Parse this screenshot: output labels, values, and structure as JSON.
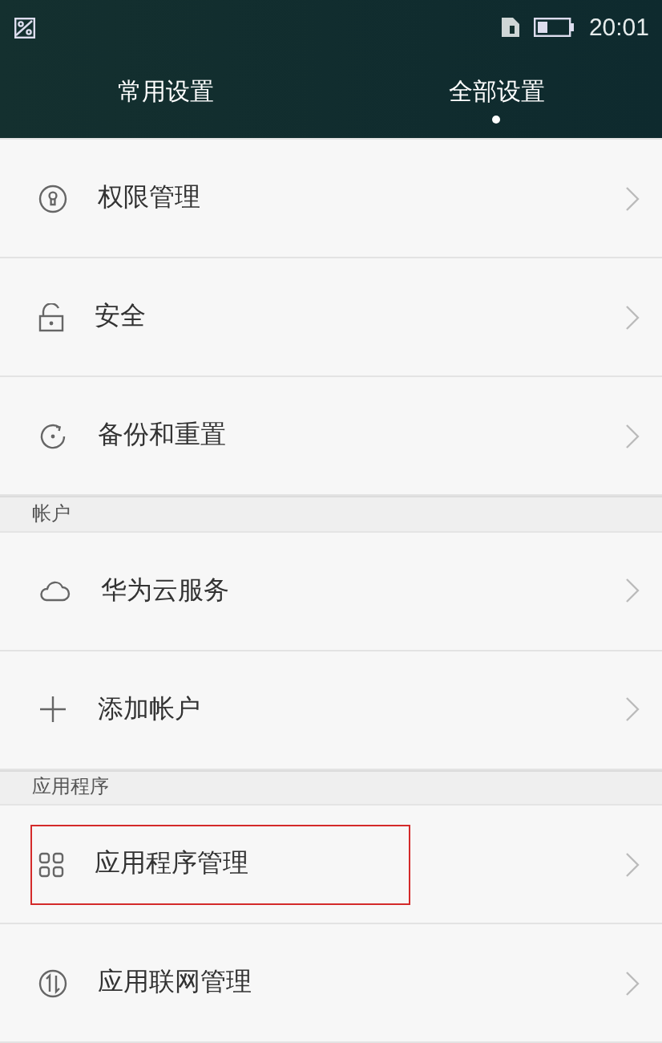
{
  "status_bar": {
    "time": "20:01"
  },
  "tabs": [
    {
      "label": "常用设置",
      "selected": false
    },
    {
      "label": "全部设置",
      "selected": true
    }
  ],
  "sections": [
    {
      "items": [
        {
          "kind": "permission",
          "label": "权限管理",
          "highlighted": false
        },
        {
          "kind": "lock",
          "label": "安全",
          "highlighted": false
        },
        {
          "kind": "reset",
          "label": "备份和重置",
          "highlighted": false
        }
      ]
    },
    {
      "title": "帐户",
      "items": [
        {
          "kind": "cloud",
          "label": "华为云服务",
          "highlighted": false
        },
        {
          "kind": "add",
          "label": "添加帐户",
          "highlighted": false
        }
      ]
    },
    {
      "title": "应用程序",
      "items": [
        {
          "kind": "apps",
          "label": "应用程序管理",
          "highlighted": true
        },
        {
          "kind": "network",
          "label": "应用联网管理",
          "highlighted": false
        }
      ]
    }
  ]
}
